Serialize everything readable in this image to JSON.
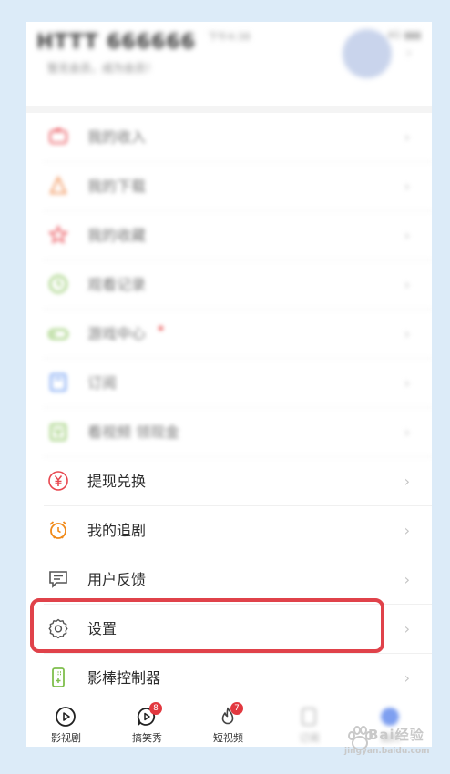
{
  "profile": {
    "username": "HTTT 666666",
    "status_time": "下午4:38",
    "status_right": "4G ▮▮▮",
    "subtitle": "暂无会员，成为会员！"
  },
  "menu": {
    "items": [
      {
        "label": "我的收入",
        "icon": "wallet-icon",
        "icon_color": "#e8474f",
        "blurred": true
      },
      {
        "label": "我的下载",
        "icon": "download-icon",
        "icon_color": "#f08a4b",
        "blurred": true
      },
      {
        "label": "我的收藏",
        "icon": "star-icon",
        "icon_color": "#e8474f",
        "blurred": true
      },
      {
        "label": "观看记录",
        "icon": "clock-icon",
        "icon_color": "#7fbf4d",
        "blurred": true
      },
      {
        "label": "游戏中心",
        "icon": "gamepad-icon",
        "icon_color": "#7fbf4d",
        "blurred": true
      },
      {
        "label": "订阅",
        "icon": "bookmark-icon",
        "icon_color": "#5b8ff0",
        "blurred": true
      },
      {
        "label": "看视频 领现金",
        "icon": "gift-icon",
        "icon_color": "#7fbf4d",
        "blurred": true
      },
      {
        "label": "提现兑换",
        "icon": "yuan-icon",
        "icon_color": "#e8474f",
        "blurred": false
      },
      {
        "label": "我的追剧",
        "icon": "alarm-clock-icon",
        "icon_color": "#f08a1a",
        "blurred": false
      },
      {
        "label": "用户反馈",
        "icon": "feedback-icon",
        "icon_color": "#555555",
        "blurred": false
      },
      {
        "label": "设置",
        "icon": "gear-icon",
        "icon_color": "#555555",
        "blurred": false
      },
      {
        "label": "影棒控制器",
        "icon": "remote-icon",
        "icon_color": "#7fbf4d",
        "blurred": false
      }
    ],
    "chevron": "›",
    "highlight_color": "#e0424a"
  },
  "tabbar": {
    "tabs": [
      {
        "label": "影视剧",
        "icon": "play-circle-icon"
      },
      {
        "label": "搞笑秀",
        "icon": "play-bubble-icon",
        "badge": "8"
      },
      {
        "label": "短视频",
        "icon": "flame-icon",
        "badge": "7"
      },
      {
        "label": "订阅",
        "icon": "subscribe-icon"
      },
      {
        "label": "我的",
        "icon": "profile-tab-icon"
      }
    ]
  },
  "watermark": {
    "brand": "Bai经验",
    "url": "jingyan.baidu.com"
  }
}
